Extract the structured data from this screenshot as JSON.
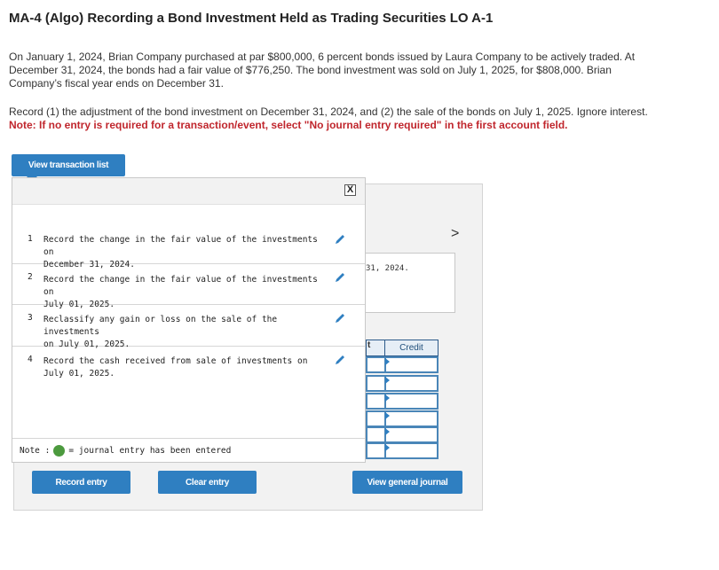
{
  "header": {
    "title": "MA-4 (Algo) Recording a Bond Investment Held as Trading Securities LO A-1"
  },
  "problem": {
    "paragraph1_line1": "On January 1, 2024, Brian Company purchased at par $800,000, 6 percent bonds issued by Laura Company to be actively traded. At",
    "paragraph1_line2": "December 31, 2024, the bonds had a fair value of $776,250. The bond investment was sold on July 1, 2025, for $808,000. Brian",
    "paragraph1_line3": "Company’s fiscal year ends on December 31.",
    "paragraph2": "Record (1) the adjustment of the bond investment on December 31, 2024, and (2) the sale of the bonds on July 1, 2025. Ignore interest.",
    "note": "Note: If no entry is required for a transaction/event, select \"No journal entry required\" in the first account field."
  },
  "buttons": {
    "view_transaction_list": "View transaction list",
    "record_entry": "Record entry",
    "clear_entry": "Clear entry",
    "view_general_journal": "View general journal"
  },
  "popup": {
    "close_label": "X",
    "transactions": [
      {
        "num": "1",
        "line1": "Record the change in the fair value of the investments on",
        "line2": "December 31, 2024."
      },
      {
        "num": "2",
        "line1": "Record the change in the fair value of the investments on",
        "line2": "July 01, 2025."
      },
      {
        "num": "3",
        "line1": "Reclassify any gain or loss on the sale of the investments",
        "line2": "on July 01, 2025."
      },
      {
        "num": "4",
        "line1": "Record the cash received from sale of investments on",
        "line2": "July 01, 2025."
      }
    ],
    "legend_prefix": "Note :",
    "legend_text": "= journal entry has been entered"
  },
  "journal_panel": {
    "next_arrow": ">",
    "description_fragment": "31, 2024.",
    "debit_fragment": "t",
    "credit_header": "Credit"
  },
  "colors": {
    "accent": "#2f7fc1",
    "note_red": "#c0262d",
    "entered_green": "#4c9a3e"
  }
}
